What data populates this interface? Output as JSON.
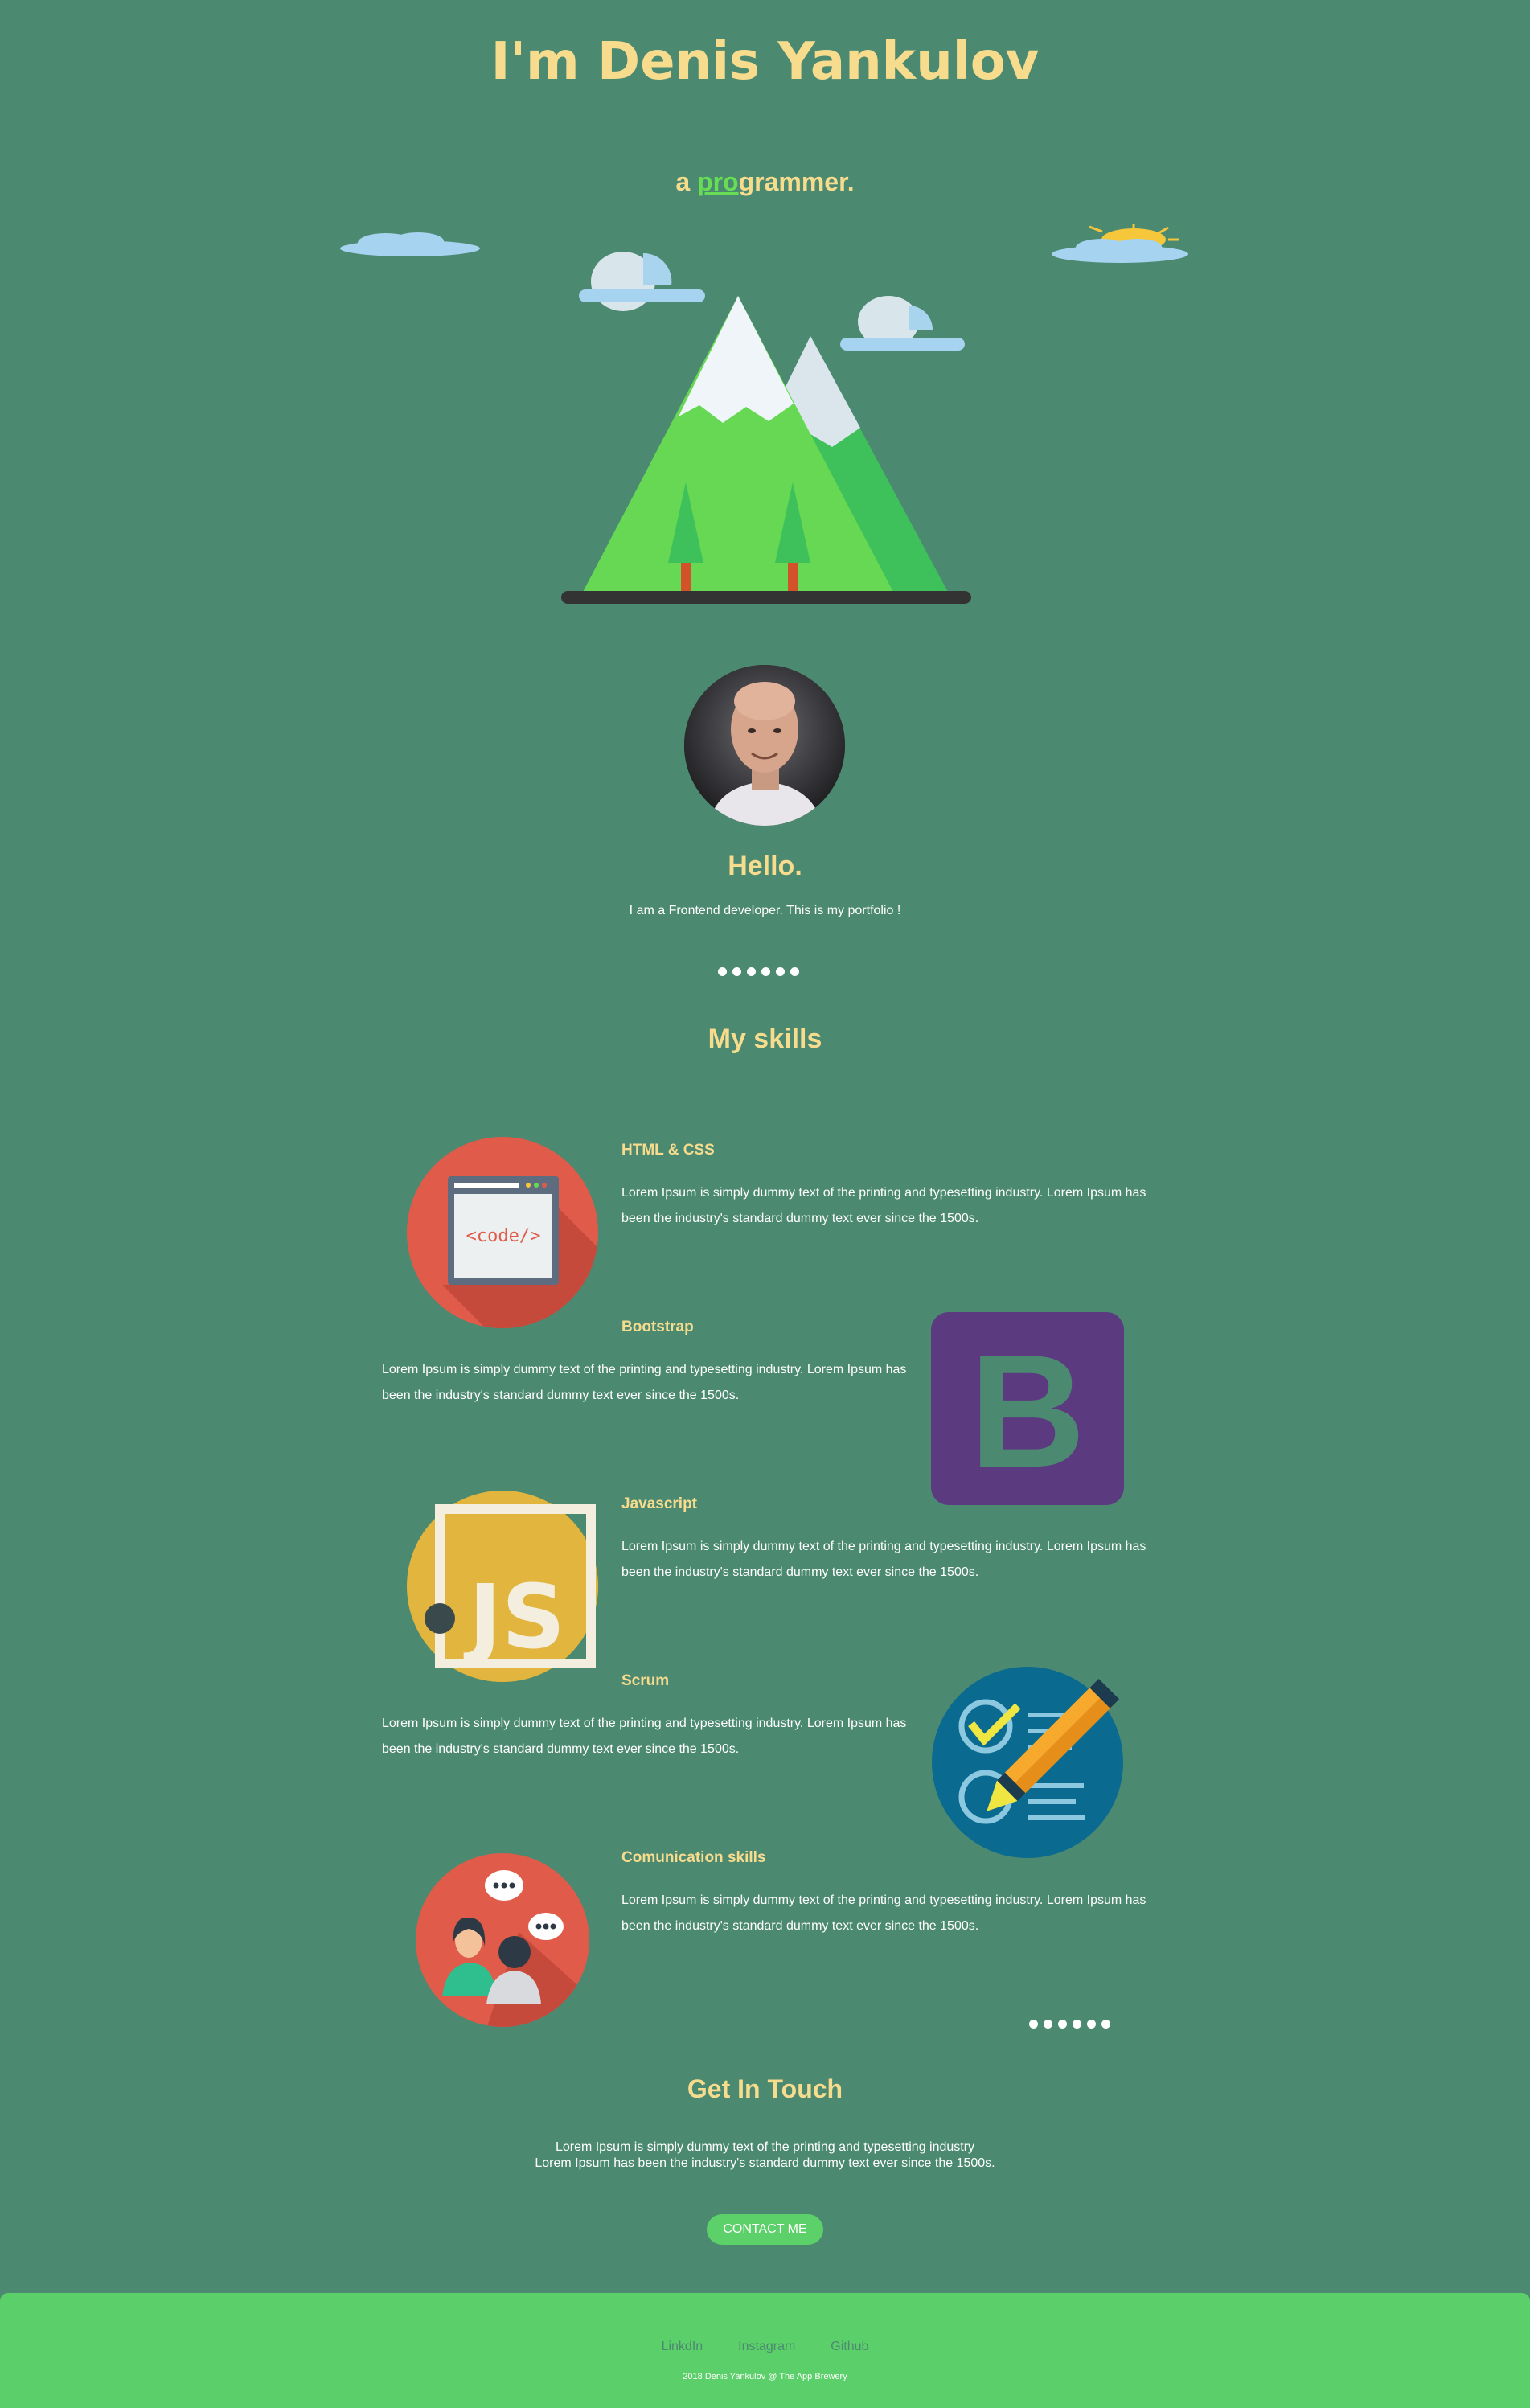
{
  "header": {
    "title": "I'm Denis Yankulov",
    "tagline_prefix": "a ",
    "tagline_highlight": "pro",
    "tagline_suffix": "grammer."
  },
  "intro": {
    "heading": "Hello.",
    "text": "I am a Frontend developer. This is my portfolio !"
  },
  "skills": {
    "heading": "My skills",
    "items": [
      {
        "title": "HTML & CSS",
        "description": "Lorem Ipsum is simply dummy text of the printing and typesetting industry. Lorem Ipsum has been the industry's standard dummy text ever since the 1500s.",
        "icon": "code-icon",
        "icon_text": "<code/>"
      },
      {
        "title": "Bootstrap",
        "description": "Lorem Ipsum is simply dummy text of the printing and typesetting industry. Lorem Ipsum has been the industry's standard dummy text ever since the 1500s.",
        "icon": "bootstrap-icon",
        "icon_text": "B"
      },
      {
        "title": "Javascript",
        "description": "Lorem Ipsum is simply dummy text of the printing and typesetting industry. Lorem Ipsum has been the industry's standard dummy text ever since the 1500s.",
        "icon": "javascript-icon",
        "icon_text": "JS"
      },
      {
        "title": "Scrum",
        "description": "Lorem Ipsum is simply dummy text of the printing and typesetting industry. Lorem Ipsum has been the industry's standard dummy text ever since the 1500s.",
        "icon": "checklist-icon"
      },
      {
        "title": "Comunication skills",
        "description": "Lorem Ipsum is simply dummy text of the printing and typesetting industry. Lorem Ipsum has been the industry's standard dummy text ever since the 1500s.",
        "icon": "chat-people-icon"
      }
    ]
  },
  "contact": {
    "heading": "Get In Touch",
    "line1": "Lorem Ipsum is simply dummy text of the printing and typesetting industry",
    "line2": "Lorem Ipsum has been the industry's standard dummy text ever since the 1500s.",
    "button_label": "CONTACT ME"
  },
  "footer": {
    "links": [
      "LinkdIn",
      "Instagram",
      "Github"
    ],
    "copyright": "2018 Denis Yankulov @ The App Brewery"
  },
  "colors": {
    "background": "#4b8971",
    "heading": "#f7dc8e",
    "accent_green": "#5cd069"
  }
}
